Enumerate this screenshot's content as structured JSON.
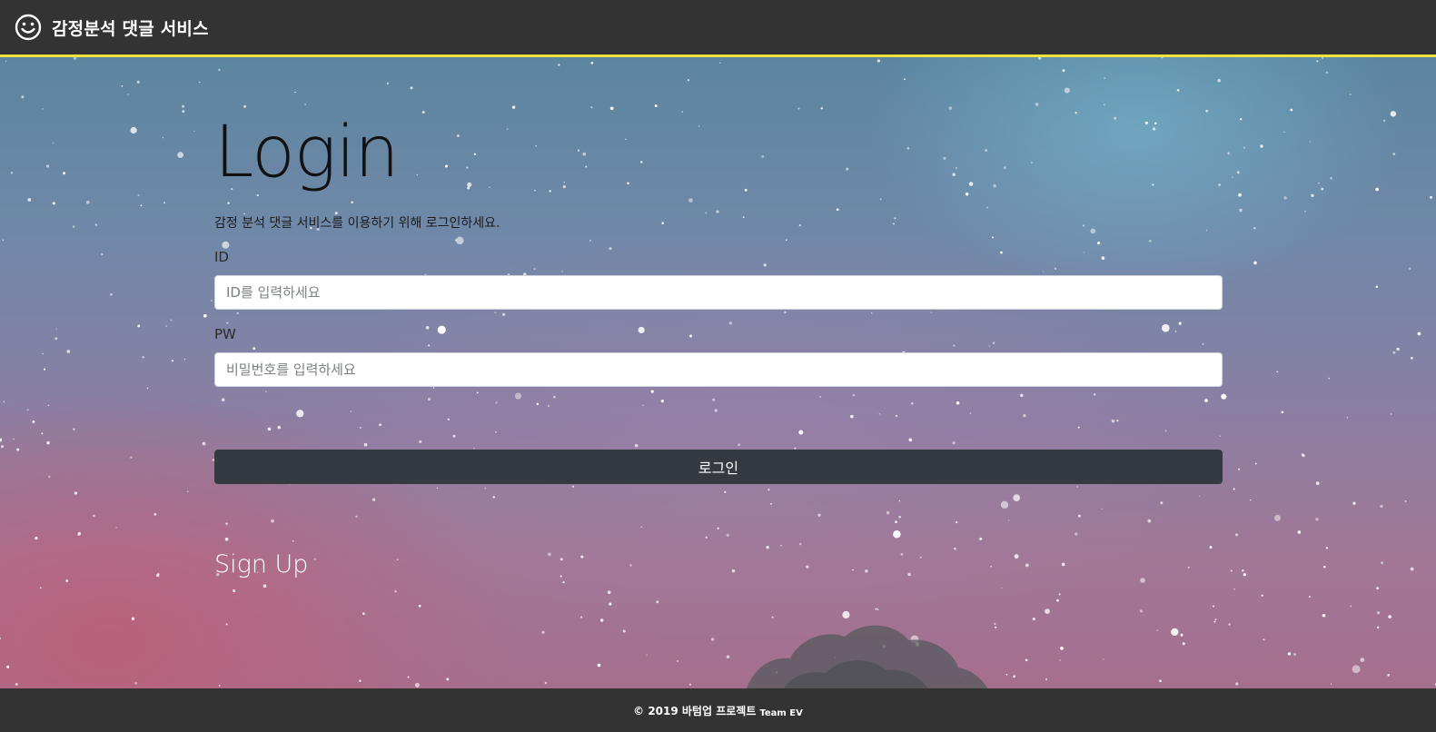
{
  "header": {
    "brand_icon": "smiley-face-icon",
    "title": "감정분석 댓글 서비스"
  },
  "colors": {
    "header_bg": "#333333",
    "header_border": "#f1e33b",
    "button_bg": "#343a40",
    "footer_bg": "#333333"
  },
  "login": {
    "title": "Login",
    "subtitle": "감정 분석 댓글 서비스를 이용하기 위해 로그인하세요.",
    "id_label": "ID",
    "id_placeholder": "ID를 입력하세요",
    "pw_label": "PW",
    "pw_placeholder": "비밀번호를 입력하세요",
    "submit_label": "로그인"
  },
  "signup": {
    "label": "Sign Up"
  },
  "footer": {
    "copyright": "© 2019 바텀업 프로젝트",
    "team": "Team EV"
  }
}
